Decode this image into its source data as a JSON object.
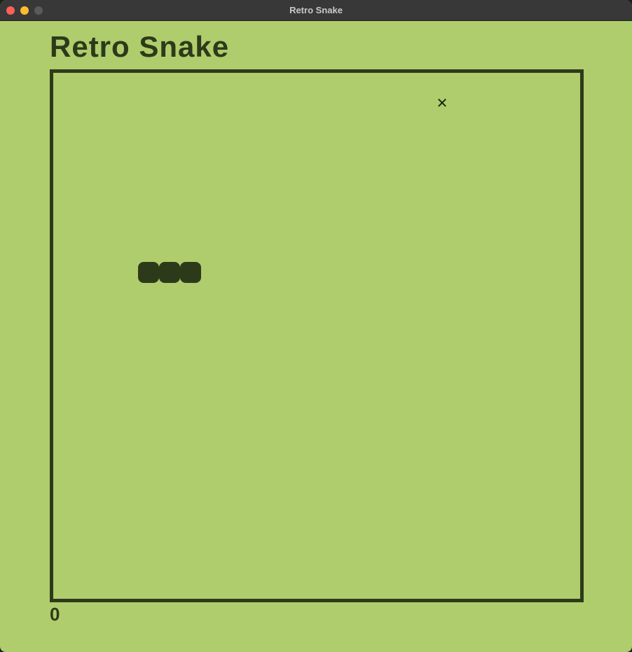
{
  "window": {
    "title": "Retro Snake"
  },
  "game": {
    "title": "Retro Snake",
    "score": "0",
    "food_icon": "x-food-icon",
    "food_glyph": "✕",
    "snake_length": 3
  },
  "colors": {
    "background": "#afcd6c",
    "foreground": "#2d3a1a",
    "titlebar": "#383838"
  }
}
